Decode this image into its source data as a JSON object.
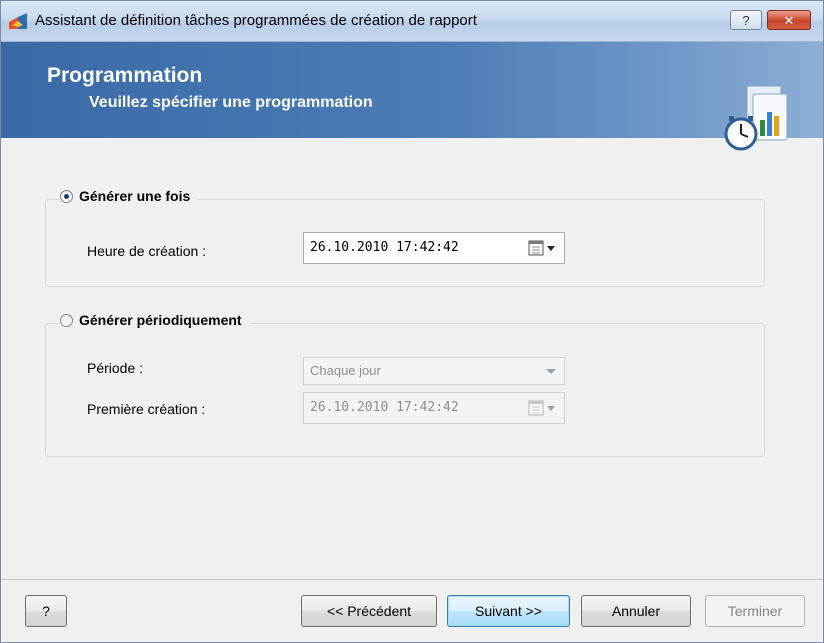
{
  "window": {
    "title": "Assistant de définition tâches programmées de création de rapport",
    "help_glyph": "?",
    "close_glyph": "✕"
  },
  "banner": {
    "title": "Programmation",
    "subtitle": "Veuillez spécifier une programmation",
    "icon": "report-schedule-icon"
  },
  "once_group": {
    "label": "Générer une fois",
    "selected": true,
    "creation_time_label": "Heure de création :",
    "creation_time_value": "26.10.2010 17:42:42"
  },
  "periodic_group": {
    "label": "Générer périodiquement",
    "selected": false,
    "period_label": "Période :",
    "period_value": "Chaque jour",
    "first_creation_label": "Première création :",
    "first_creation_value": "26.10.2010 17:42:42"
  },
  "buttons": {
    "help": "?",
    "previous": "<< Précédent",
    "next": "Suivant >>",
    "cancel": "Annuler",
    "finish": "Terminer"
  },
  "colors": {
    "banner": "#4d7db6",
    "default_button": "#3c7fb1"
  }
}
